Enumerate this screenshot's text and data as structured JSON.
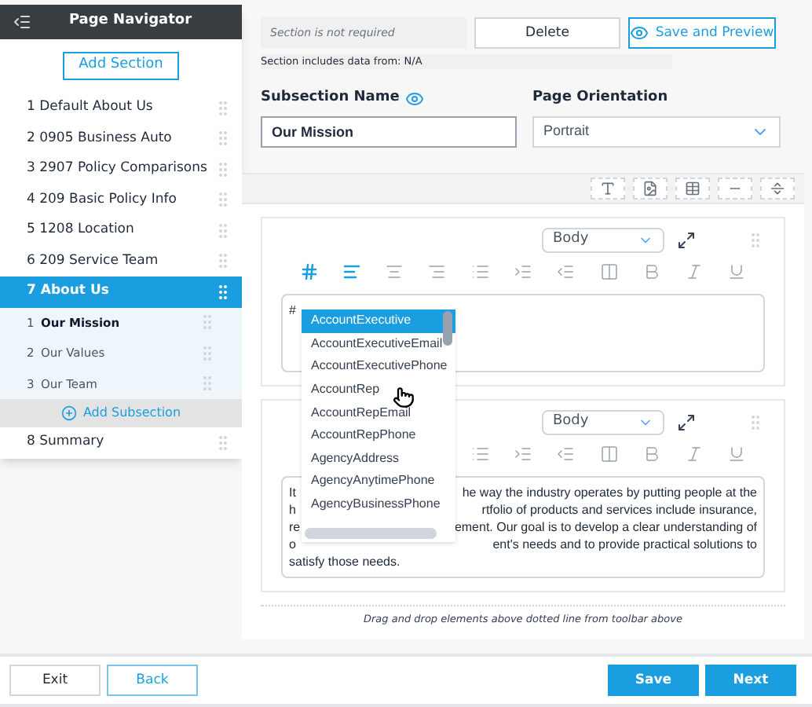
{
  "sidebar": {
    "title": "Page Navigator",
    "add_section": "Add Section",
    "sections": [
      {
        "label": "1 Default About Us",
        "selected": false
      },
      {
        "label": "2 0905 Business Auto",
        "selected": false
      },
      {
        "label": "3 2907 Policy Comparisons",
        "selected": false
      },
      {
        "label": "4 209 Basic Policy Info",
        "selected": false
      },
      {
        "label": "5 1208 Location",
        "selected": false
      },
      {
        "label": "6 209 Service Team",
        "selected": false
      },
      {
        "label": "7 About Us",
        "selected": true,
        "expanded": true,
        "subsections": [
          {
            "number": "1",
            "label": "Our Mission",
            "selected": true
          },
          {
            "number": "2",
            "label": "Our Values",
            "selected": false
          },
          {
            "number": "3",
            "label": "Our Team",
            "selected": false
          }
        ],
        "add_subsection": "Add Subsection"
      },
      {
        "label": "8 Summary",
        "selected": false
      }
    ]
  },
  "header": {
    "notice": "Section is not required",
    "delete": "Delete",
    "save_preview": "Save and Preview",
    "data_from": "Section includes data from: N/A"
  },
  "subsection_name": {
    "label": "Subsection Name",
    "value": "Our Mission"
  },
  "page_orientation": {
    "label": "Page Orientation",
    "value": "Portrait"
  },
  "editors": [
    {
      "style": "Body",
      "toolbar": [
        {
          "kind": "hash",
          "active": true
        },
        {
          "kind": "align-left",
          "active": true
        },
        {
          "kind": "align-center",
          "active": false
        },
        {
          "kind": "align-right",
          "active": false
        },
        {
          "kind": "list",
          "active": false
        },
        {
          "kind": "indent",
          "active": false
        },
        {
          "kind": "outdent",
          "active": false
        },
        {
          "kind": "columns",
          "active": false
        },
        {
          "kind": "bold",
          "active": false
        },
        {
          "kind": "italic",
          "active": false
        },
        {
          "kind": "underline",
          "active": false
        }
      ],
      "lines": [
        {
          "left": "#"
        }
      ]
    },
    {
      "style": "Body",
      "toolbar": [
        {
          "kind": "list",
          "active": false
        },
        {
          "kind": "indent",
          "active": false
        },
        {
          "kind": "outdent",
          "active": false
        },
        {
          "kind": "columns",
          "active": false
        },
        {
          "kind": "bold",
          "active": false
        },
        {
          "kind": "italic",
          "active": false
        },
        {
          "kind": "underline",
          "active": false
        }
      ],
      "lines": [
        {
          "left": "It",
          "right": "he way the industry operates by putting people at the"
        },
        {
          "left": "h",
          "right": "rtfolio of products and services include insurance,"
        },
        {
          "left": "re",
          "right": "ement. Our goal is to develop a clear understanding of"
        },
        {
          "left": "o",
          "right": "ent's needs and to provide practical solutions to"
        },
        {
          "left": "satisfy those needs."
        }
      ]
    }
  ],
  "autocomplete": [
    {
      "label": "AccountExecutive",
      "selected": true
    },
    {
      "label": "AccountExecutiveEmail",
      "selected": false
    },
    {
      "label": "AccountExecutivePhone",
      "selected": false
    },
    {
      "label": "AccountRep",
      "selected": false
    },
    {
      "label": "AccountRepEmail",
      "selected": false
    },
    {
      "label": "AccountRepPhone",
      "selected": false
    },
    {
      "label": "AgencyAddress",
      "selected": false
    },
    {
      "label": "AgencyAnytimePhone",
      "selected": false
    },
    {
      "label": "AgencyBusinessPhone",
      "selected": false
    }
  ],
  "drop_hint": "Drag and drop elements above dotted line from toolbar above",
  "footer": {
    "exit": "Exit",
    "back": "Back",
    "save": "Save",
    "next": "Next"
  }
}
